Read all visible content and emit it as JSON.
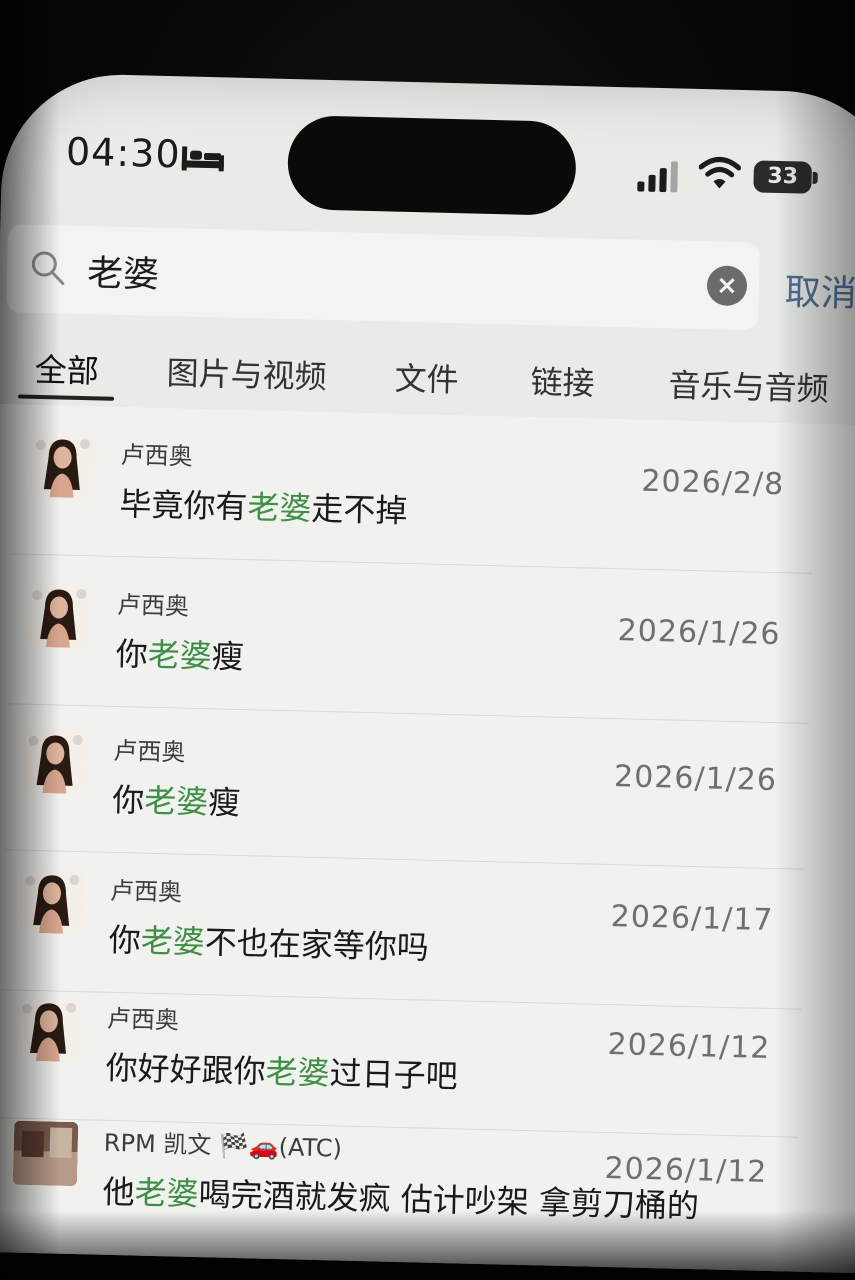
{
  "status_bar": {
    "time": "04:30",
    "battery": "33",
    "icons": [
      "bed-icon",
      "signal-icon",
      "wifi-icon",
      "battery-icon"
    ]
  },
  "search": {
    "query": "老婆",
    "cancel_label": "取消"
  },
  "tabs": [
    {
      "label": "全部",
      "active": true
    },
    {
      "label": "图片与视频",
      "active": false
    },
    {
      "label": "文件",
      "active": false
    },
    {
      "label": "链接",
      "active": false
    },
    {
      "label": "音乐与音频",
      "active": false
    }
  ],
  "results": [
    {
      "sender": "卢西奥",
      "pre": "毕竟你有",
      "highlight": "老婆",
      "post": "走不掉",
      "date": "2026/2/8"
    },
    {
      "sender": "卢西奥",
      "pre": "你",
      "highlight": "老婆",
      "post": "瘦",
      "date": "2026/1/26"
    },
    {
      "sender": "卢西奥",
      "pre": "你",
      "highlight": "老婆",
      "post": "瘦",
      "date": "2026/1/26"
    },
    {
      "sender": "卢西奥",
      "pre": "你",
      "highlight": "老婆",
      "post": "不也在家等你吗",
      "date": "2026/1/17"
    },
    {
      "sender": "卢西奥",
      "pre": "你好好跟你",
      "highlight": "老婆",
      "post": "过日子吧",
      "date": "2026/1/12"
    },
    {
      "sender": "RPM 凯文 🏁🚗(ATC)",
      "pre": "他",
      "highlight": "老婆",
      "post": "喝完酒就发疯 估计吵架 拿剪刀桶的",
      "date": "2026/1/12"
    }
  ],
  "colors": {
    "highlight": "#3f8f45",
    "cancel": "#4f6e94",
    "background": "#e9ebe7"
  }
}
